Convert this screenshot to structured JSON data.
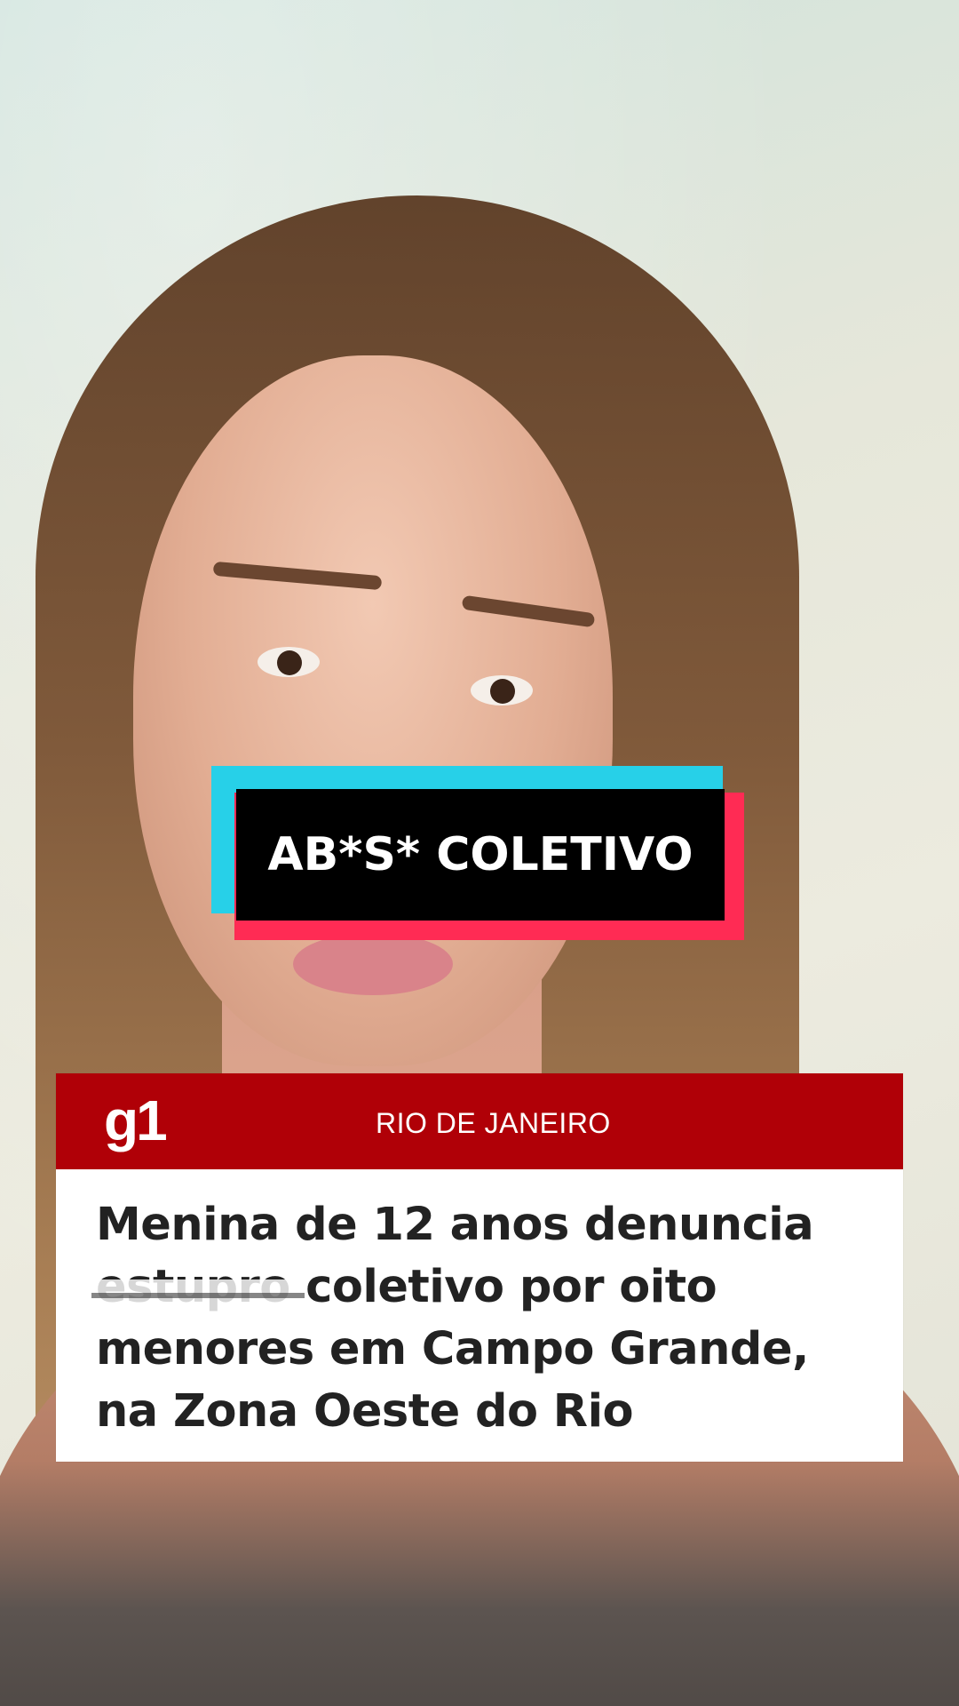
{
  "video": {
    "description_alt": ""
  },
  "overlay_caption": {
    "text": "AB*S* COLETIVO",
    "colors": {
      "cyan": "#27d0e8",
      "red": "#ff2b54",
      "black": "#000000",
      "text": "#ffffff"
    }
  },
  "news_card": {
    "logo": "g1",
    "section": "RIO DE JANEIRO",
    "headline": "Menina de 12 anos denuncia estupro coletivo por oito menores em Campo Grande, na Zona Oeste do Rio",
    "colors": {
      "header_background": "#b00007",
      "header_text": "#ffffff",
      "body_background": "#ffffff",
      "headline_text": "#222222"
    }
  }
}
